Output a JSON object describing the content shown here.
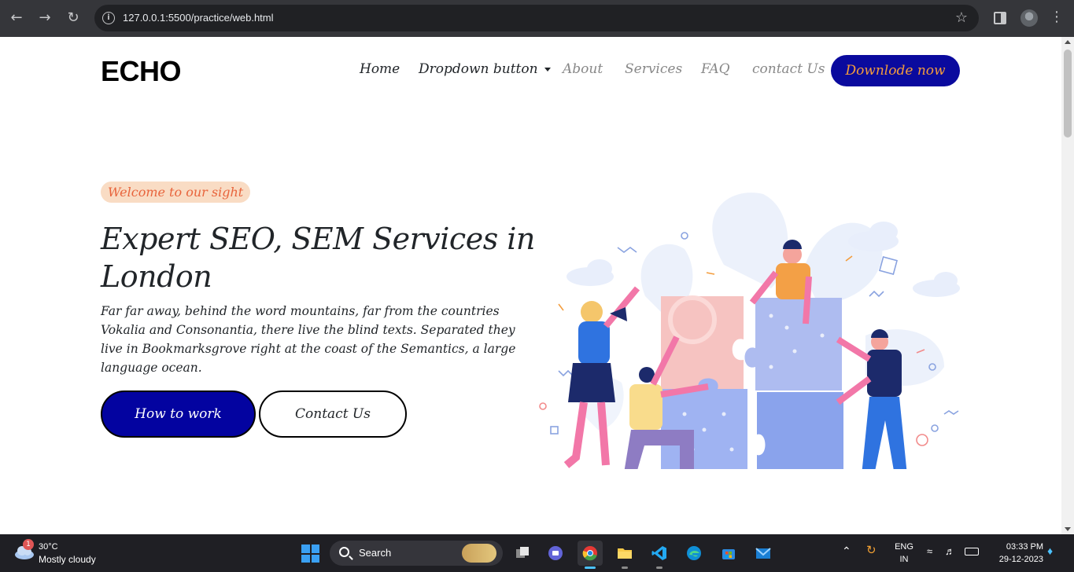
{
  "browser": {
    "url": "127.0.0.1:5500/practice/web.html"
  },
  "site": {
    "logo": "ECHO",
    "nav": [
      {
        "label": "Home"
      },
      {
        "label": "Dropdown button"
      },
      {
        "label": "About"
      },
      {
        "label": "Services"
      },
      {
        "label": "FAQ"
      },
      {
        "label": "contact Us"
      }
    ],
    "download_label": "Downlode now",
    "accent_color": "#0a0a9e",
    "cta_text_color": "#f39c3c"
  },
  "hero": {
    "badge": "Welcome to our sight",
    "title": "Expert SEO, SEM Services in London",
    "description": "Far far away, behind the word mountains, far from the countries Vokalia and Consonantia, there live the blind texts. Separated they live in Bookmarksgrove right at the coast of the Semantics, a large language ocean.",
    "primary_button": "How to work",
    "secondary_button": "Contact Us",
    "illustration": "team-assembling-puzzle-illustration"
  },
  "taskbar": {
    "weather": {
      "temp": "30°C",
      "desc": "Mostly cloudy",
      "badge": "1"
    },
    "search_label": "Search",
    "apps": [
      "task-view",
      "teams-chat",
      "chrome",
      "file-explorer",
      "vscode",
      "edge",
      "microsoft-store",
      "mail"
    ],
    "active_app": "chrome",
    "language": {
      "line1": "ENG",
      "line2": "IN"
    },
    "time": "03:33 PM",
    "date": "29-12-2023"
  }
}
